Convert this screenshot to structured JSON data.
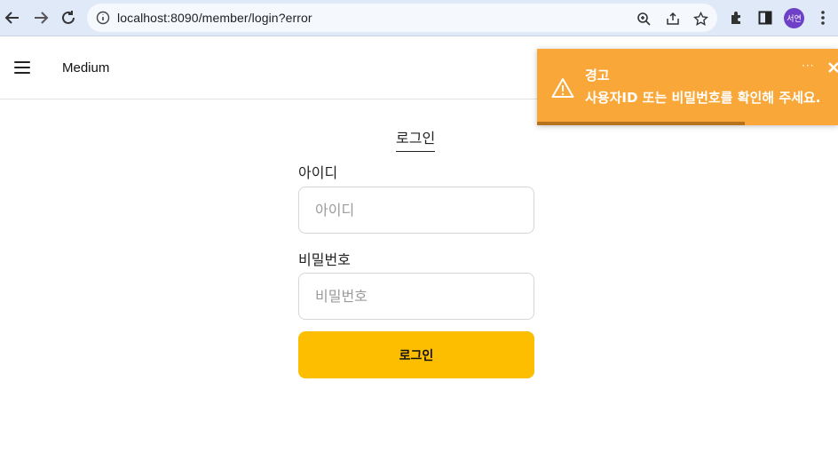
{
  "browser": {
    "url": "localhost:8090/member/login?error",
    "profile_initials": "서연",
    "icons": [
      "back-icon",
      "forward-icon",
      "reload-icon",
      "info-icon",
      "zoom-icon",
      "share-icon",
      "bookmark-star-icon",
      "extensions-icon",
      "side-panel-icon",
      "kebab-menu-icon"
    ]
  },
  "header": {
    "brand": "Medium",
    "menu_icon": "hamburger-icon"
  },
  "login": {
    "title": "로그인",
    "id_label": "아이디",
    "id_placeholder": "아이디",
    "password_label": "비밀번호",
    "password_placeholder": "비밀번호",
    "submit_label": "로그인"
  },
  "toast": {
    "title": "경고",
    "message": "사용자ID 또는 비밀번호를 확인해 주세요.",
    "dots": "···",
    "progress_fraction": 0.69,
    "icon": "warning-icon"
  },
  "colors": {
    "toast_bg": "#f8a738",
    "toast_progress": "#b7731c",
    "button_accent": "#fdbe00",
    "avatar": "#6e3fc7"
  }
}
